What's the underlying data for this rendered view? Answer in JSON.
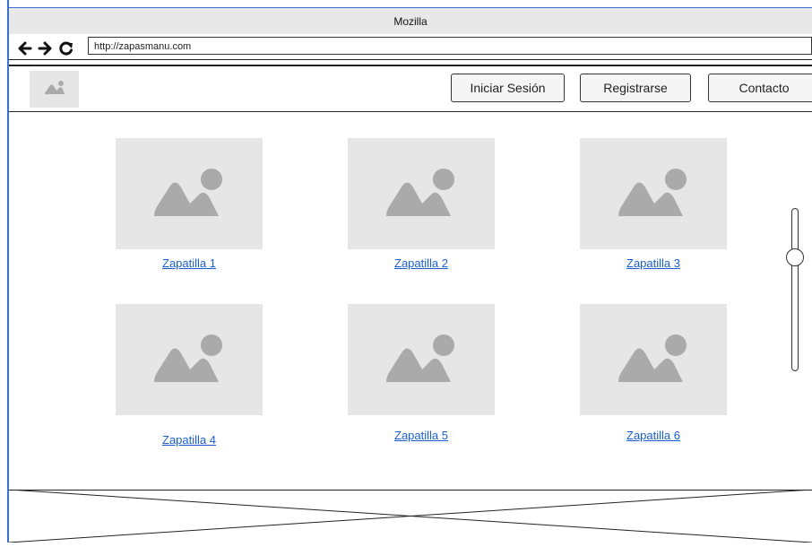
{
  "window": {
    "title": "Mozilla"
  },
  "browser": {
    "url": "http://zapasmanu.com",
    "back_icon": "arrow-left-icon",
    "forward_icon": "arrow-right-icon",
    "reload_icon": "reload-icon"
  },
  "header": {
    "logo_icon": "image-placeholder-icon",
    "buttons": {
      "login": "Iniciar Sesión",
      "register": "Registrarse",
      "contact": "Contacto"
    }
  },
  "products": [
    {
      "label": "Zapatilla 1"
    },
    {
      "label": "Zapatilla 2"
    },
    {
      "label": "Zapatilla 3"
    },
    {
      "label": "Zapatilla 4"
    },
    {
      "label": "Zapatilla 5"
    },
    {
      "label": "Zapatilla 6"
    }
  ],
  "scroll": {
    "position_fraction": 0.28
  },
  "colors": {
    "accent": "#3b6fd1",
    "link": "#1a5fd0",
    "placeholder_bg": "#e6e6e6",
    "placeholder_icon": "#aaaaaa"
  }
}
